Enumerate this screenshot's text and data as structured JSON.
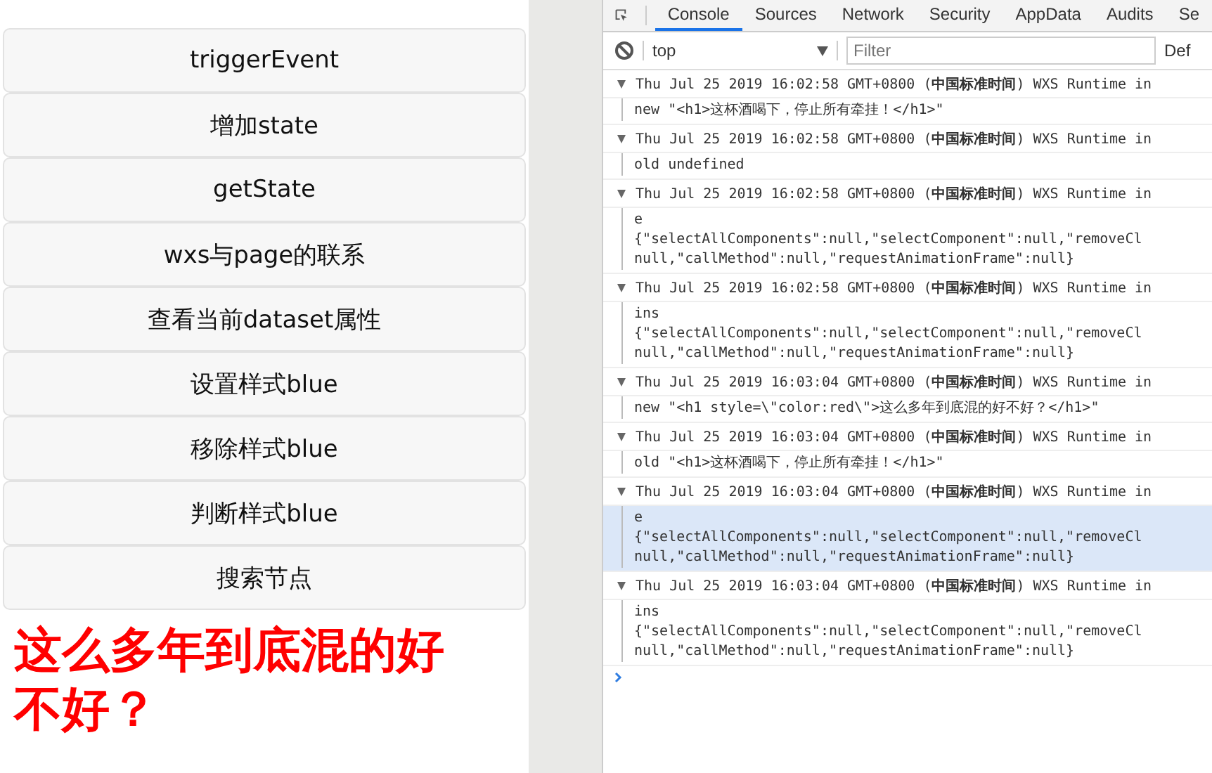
{
  "phone": {
    "buttons": [
      "triggerEvent",
      "增加state",
      "getState",
      "wxs与page的联系",
      "查看当前dataset属性",
      "设置样式blue",
      "移除样式blue",
      "判断样式blue",
      "搜索节点"
    ],
    "heading": "这么多年到底混的好不好？"
  },
  "devtools": {
    "tabs": [
      {
        "label": "Console",
        "selected": true
      },
      {
        "label": "Sources",
        "selected": false
      },
      {
        "label": "Network",
        "selected": false
      },
      {
        "label": "Security",
        "selected": false
      },
      {
        "label": "AppData",
        "selected": false
      },
      {
        "label": "Audits",
        "selected": false
      },
      {
        "label": "Se",
        "selected": false
      }
    ],
    "context": "top",
    "filter_placeholder": "Filter",
    "levels": "Def",
    "logs": [
      {
        "header": "Thu Jul 25 2019 16:02:58 GMT+0800 (**中国标准时间**) WXS Runtime in",
        "lines": [
          "new \"<h1>这杯酒喝下，停止所有牵挂！</h1>\""
        ],
        "selected": false
      },
      {
        "header": "Thu Jul 25 2019 16:02:58 GMT+0800 (**中国标准时间**) WXS Runtime in",
        "lines": [
          "old undefined"
        ],
        "selected": false
      },
      {
        "header": "Thu Jul 25 2019 16:02:58 GMT+0800 (**中国标准时间**) WXS Runtime in",
        "lines": [
          "e",
          "{\"selectAllComponents\":null,\"selectComponent\":null,\"removeCl",
          "null,\"callMethod\":null,\"requestAnimationFrame\":null}"
        ],
        "selected": false
      },
      {
        "header": "Thu Jul 25 2019 16:02:58 GMT+0800 (**中国标准时间**) WXS Runtime in",
        "lines": [
          "ins",
          "{\"selectAllComponents\":null,\"selectComponent\":null,\"removeCl",
          "null,\"callMethod\":null,\"requestAnimationFrame\":null}"
        ],
        "selected": false
      },
      {
        "header": "Thu Jul 25 2019 16:03:04 GMT+0800 (**中国标准时间**) WXS Runtime in",
        "lines": [
          "new \"<h1 style=\\\"color:red\\\">这么多年到底混的好不好？</h1>\""
        ],
        "selected": false
      },
      {
        "header": "Thu Jul 25 2019 16:03:04 GMT+0800 (**中国标准时间**) WXS Runtime in",
        "lines": [
          "old \"<h1>这杯酒喝下，停止所有牵挂！</h1>\""
        ],
        "selected": false
      },
      {
        "header": "Thu Jul 25 2019 16:03:04 GMT+0800 (**中国标准时间**) WXS Runtime in",
        "lines": [
          "e",
          "{\"selectAllComponents\":null,\"selectComponent\":null,\"removeCl",
          "null,\"callMethod\":null,\"requestAnimationFrame\":null}"
        ],
        "selected": true
      },
      {
        "header": "Thu Jul 25 2019 16:03:04 GMT+0800 (**中国标准时间**) WXS Runtime in",
        "lines": [
          "ins",
          "{\"selectAllComponents\":null,\"selectComponent\":null,\"removeCl",
          "null,\"callMethod\":null,\"requestAnimationFrame\":null}"
        ],
        "selected": false
      }
    ]
  }
}
